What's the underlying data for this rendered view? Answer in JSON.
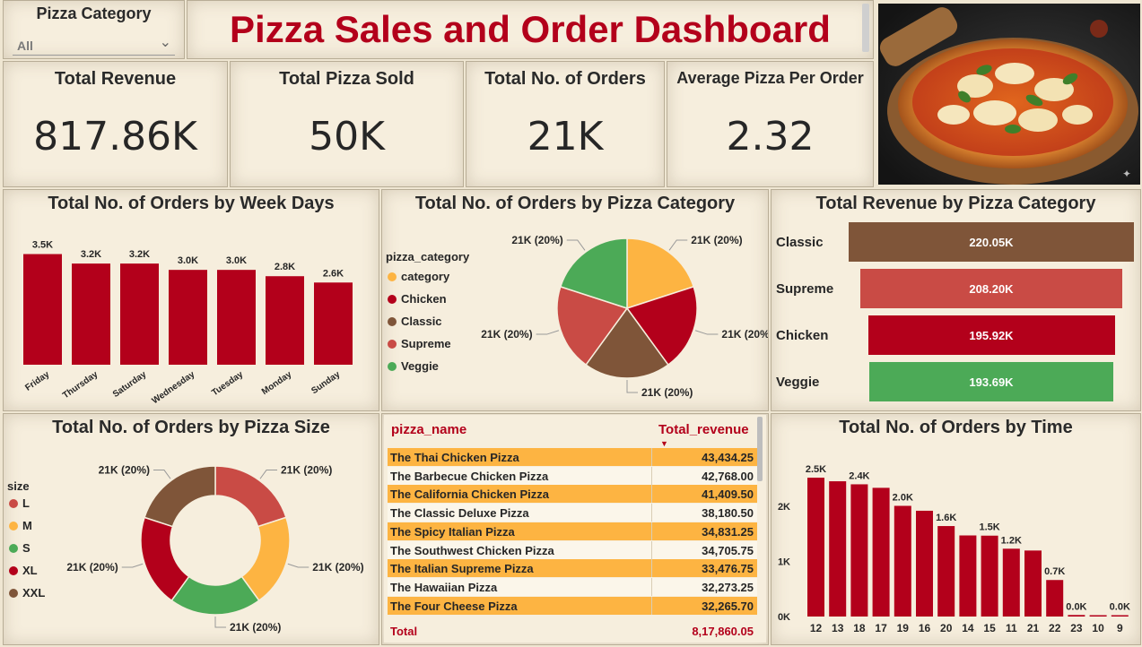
{
  "slicer": {
    "label": "Pizza Category",
    "value": "All"
  },
  "header": {
    "title": "Pizza Sales and Order Dashboard"
  },
  "kpis": [
    {
      "title": "Total Revenue",
      "value": "817.86K"
    },
    {
      "title": "Total Pizza Sold",
      "value": "50K"
    },
    {
      "title": "Total No. of Orders",
      "value": "21K"
    },
    {
      "title": "Average Pizza Per Order",
      "value": "2.32"
    }
  ],
  "colors": {
    "red": "#b3001b",
    "orange": "#fdb442",
    "brown": "#7f5539",
    "salmon": "#c94b45",
    "green": "#4caa57"
  },
  "chart_data": [
    {
      "type": "bar",
      "title": "Total No. of Orders by Week Days",
      "categories": [
        "Friday",
        "Thursday",
        "Saturday",
        "Wednesday",
        "Tuesday",
        "Monday",
        "Sunday"
      ],
      "values": [
        3500,
        3200,
        3200,
        3000,
        3000,
        2800,
        2600
      ],
      "labels": [
        "3.5K",
        "3.2K",
        "3.2K",
        "3.0K",
        "3.0K",
        "2.8K",
        "2.6K"
      ],
      "ylim": [
        0,
        3600
      ],
      "color": "#b3001b"
    },
    {
      "type": "pie",
      "title": "Total No. of Orders by Pizza Category",
      "legend_title": "pizza_category",
      "categories": [
        "category",
        "Chicken",
        "Classic",
        "Supreme",
        "Veggie"
      ],
      "values": [
        20,
        20,
        20,
        20,
        20
      ],
      "labels": [
        "21K (20%)",
        "21K (20%)",
        "21K (20%)",
        "21K (20%)",
        "21K (20%)"
      ],
      "colors": [
        "#fdb442",
        "#b3001b",
        "#7f5539",
        "#c94b45",
        "#4caa57"
      ],
      "legend": "left"
    },
    {
      "type": "bar",
      "orientation": "horizontal-funnel",
      "title": "Total Revenue by Pizza Category",
      "categories": [
        "Classic",
        "Supreme",
        "Chicken",
        "Veggie"
      ],
      "values": [
        220050,
        208200,
        195920,
        193690
      ],
      "labels": [
        "220.05K",
        "208.20K",
        "195.92K",
        "193.69K"
      ],
      "colors": [
        "#7f5539",
        "#c94b45",
        "#b3001b",
        "#4caa57"
      ]
    },
    {
      "type": "pie",
      "style": "donut",
      "title": "Total No. of Orders by Pizza Size",
      "legend_title": "size",
      "categories": [
        "L",
        "M",
        "S",
        "XL",
        "XXL"
      ],
      "values": [
        20,
        20,
        20,
        20,
        20
      ],
      "labels": [
        "21K (20%)",
        "21K (20%)",
        "21K (20%)",
        "21K (20%)",
        "21K (20%)"
      ],
      "colors": [
        "#c94b45",
        "#fdb442",
        "#4caa57",
        "#b3001b",
        "#7f5539"
      ],
      "legend": "left"
    },
    {
      "type": "table",
      "columns": [
        "pizza_name",
        "Total_revenue"
      ],
      "rows": [
        [
          "The Thai Chicken Pizza",
          "43,434.25"
        ],
        [
          "The Barbecue Chicken Pizza",
          "42,768.00"
        ],
        [
          "The California Chicken Pizza",
          "41,409.50"
        ],
        [
          "The Classic Deluxe Pizza",
          "38,180.50"
        ],
        [
          "The Spicy Italian Pizza",
          "34,831.25"
        ],
        [
          "The Southwest Chicken Pizza",
          "34,705.75"
        ],
        [
          "The Italian Supreme Pizza",
          "33,476.75"
        ],
        [
          "The Hawaiian Pizza",
          "32,273.25"
        ],
        [
          "The Four Cheese Pizza",
          "32,265.70"
        ]
      ],
      "total": [
        "Total",
        "8,17,860.05"
      ]
    },
    {
      "type": "bar",
      "title": "Total No. of Orders by Time",
      "categories": [
        "12",
        "13",
        "18",
        "17",
        "19",
        "16",
        "20",
        "14",
        "15",
        "11",
        "21",
        "22",
        "23",
        "10",
        "9"
      ],
      "values": [
        2520,
        2455,
        2400,
        2336,
        2009,
        1920,
        1642,
        1472,
        1468,
        1231,
        1198,
        663,
        28,
        8,
        1
      ],
      "labels": [
        "2.5K",
        "",
        "2.4K",
        "",
        "2.0K",
        "",
        "1.6K",
        "",
        "1.5K",
        "1.2K",
        "",
        "0.7K",
        "0.0K",
        "",
        "0.0K"
      ],
      "yticks": [
        "0K",
        "1K",
        "2K"
      ],
      "ylim": [
        0,
        2700
      ],
      "color": "#b3001b"
    }
  ]
}
